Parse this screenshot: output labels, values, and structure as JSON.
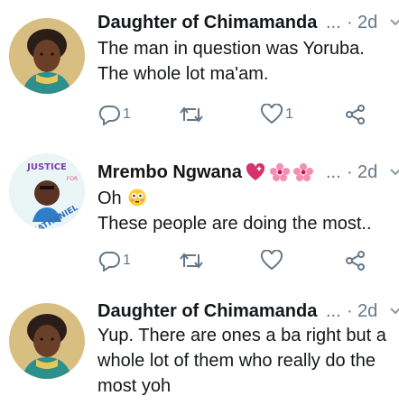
{
  "tweets": [
    {
      "name": "Daughter of Chimamanda",
      "ellipsis": "...",
      "time": "2d",
      "lines": [
        "The man in question was Yoruba.",
        "The whole lot ma'am."
      ],
      "reply_count": "1",
      "like_count": "1",
      "avatar": "portrait-avatar"
    },
    {
      "name": "Mrembo Ngwana",
      "ellipsis": "...",
      "time": "2d",
      "lines": [
        "Oh",
        "These people are doing the most.."
      ],
      "reply_count": "1",
      "like_count": "",
      "avatar": "justice-for-nathaniel-avatar",
      "avatar_text_top": "JUSTICE",
      "avatar_text_for": "FOR",
      "avatar_text_bottom": "NATHANIEL"
    },
    {
      "name": "Daughter of Chimamanda",
      "ellipsis": "...",
      "time": "2d",
      "lines": [
        "Yup. There are ones a ba right but a",
        "whole lot of them who really do the",
        "most yoh"
      ],
      "avatar": "portrait-avatar"
    }
  ],
  "colors": {
    "text": "#14171a",
    "muted": "#657786"
  },
  "icons": [
    "reply-icon",
    "retweet-icon",
    "like-icon",
    "share-icon",
    "chevron-down-icon",
    "flushed-face-emoji",
    "sparkling-heart-emoji",
    "cherry-blossom-emoji"
  ]
}
